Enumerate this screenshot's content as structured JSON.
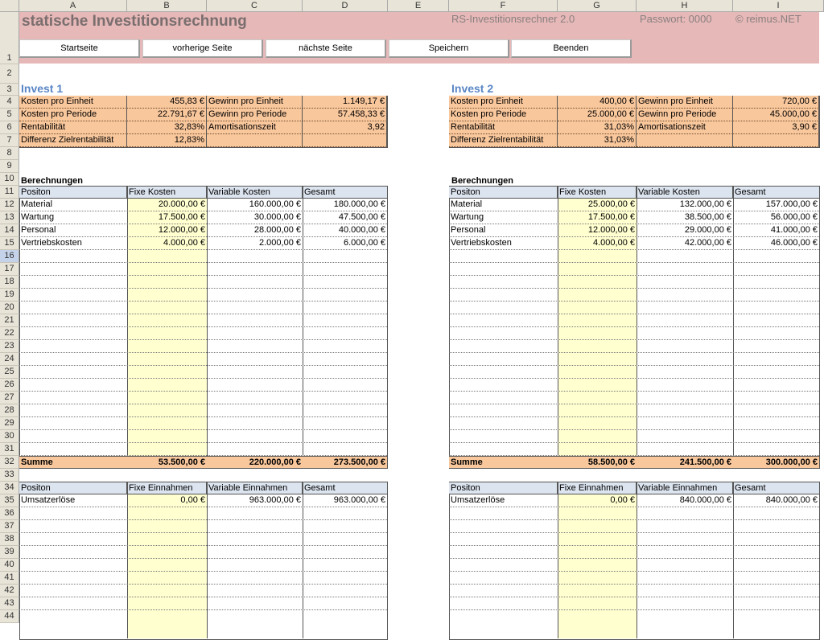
{
  "columns": [
    "A",
    "B",
    "C",
    "D",
    "E",
    "F",
    "G",
    "H",
    "I"
  ],
  "rows": [
    "1",
    "2",
    "3",
    "4",
    "5",
    "6",
    "7",
    "8",
    "9",
    "10",
    "11",
    "12",
    "13",
    "14",
    "15",
    "16",
    "17",
    "18",
    "19",
    "20",
    "21",
    "22",
    "23",
    "24",
    "25",
    "26",
    "27",
    "28",
    "29",
    "30",
    "31",
    "32",
    "33",
    "34",
    "35",
    "36",
    "37",
    "38",
    "39",
    "40",
    "41",
    "42",
    "43",
    "44"
  ],
  "header": {
    "title": "statische Investitionsrechnung",
    "app_name": "RS-Investitionsrechner 2.0",
    "password": "Passwort: 0000",
    "copyright": "© reimus.NET"
  },
  "buttons": {
    "start": "Startseite",
    "prev": "vorherige Seite",
    "next": "nächste Seite",
    "save": "Speichern",
    "exit": "Beenden"
  },
  "colors": {
    "banner": "#e6b8b8",
    "orange": "#f9c79c",
    "yellow": "#ffffd0",
    "header": "#dce4ef",
    "title_blue": "#5a86c6"
  },
  "invest1": {
    "title": "Invest 1",
    "kpi": [
      [
        "Kosten pro Einheit",
        "455,83 €",
        "Gewinn pro Einheit",
        "1.149,17 €"
      ],
      [
        "Kosten pro Periode",
        "22.791,67 €",
        "Gewinn pro Periode",
        "57.458,33 €"
      ],
      [
        "Rentabilität",
        "32,83%",
        "Amortisationszeit",
        "3,92"
      ],
      [
        "Differenz Zielrentabilität",
        "12,83%",
        "",
        ""
      ]
    ],
    "calc_title": "Berechnungen",
    "cost_headers": [
      "Positon",
      "Fixe Kosten",
      "Variable Kosten",
      "Gesamt"
    ],
    "cost_rows": [
      [
        "Material",
        "20.000,00 €",
        "160.000,00 €",
        "180.000,00 €"
      ],
      [
        "Wartung",
        "17.500,00 €",
        "30.000,00 €",
        "47.500,00 €"
      ],
      [
        "Personal",
        "12.000,00 €",
        "28.000,00 €",
        "40.000,00 €"
      ],
      [
        "Vertriebskosten",
        "4.000,00 €",
        "2.000,00 €",
        "6.000,00 €"
      ]
    ],
    "sum": [
      "Summe",
      "53.500,00 €",
      "220.000,00 €",
      "273.500,00 €"
    ],
    "rev_headers": [
      "Positon",
      "Fixe Einnahmen",
      "Variable Einnahmen",
      "Gesamt"
    ],
    "rev_rows": [
      [
        "Umsatzerlöse",
        "0,00 €",
        "963.000,00 €",
        "963.000,00 €"
      ]
    ]
  },
  "invest2": {
    "title": "Invest 2",
    "kpi": [
      [
        "Kosten pro Einheit",
        "400,00 €",
        "Gewinn pro Einheit",
        "720,00 €"
      ],
      [
        "Kosten pro Periode",
        "25.000,00 €",
        "Gewinn pro Periode",
        "45.000,00 €"
      ],
      [
        "Rentabilität",
        "31,03%",
        "Amortisationszeit",
        "3,90 €"
      ],
      [
        "Differenz Zielrentabilität",
        "31,03%",
        "",
        ""
      ]
    ],
    "calc_title": "Berechnungen",
    "cost_headers": [
      "Positon",
      "Fixe Kosten",
      "Variable Kosten",
      "Gesamt"
    ],
    "cost_rows": [
      [
        "Material",
        "25.000,00 €",
        "132.000,00 €",
        "157.000,00 €"
      ],
      [
        "Wartung",
        "17.500,00 €",
        "38.500,00 €",
        "56.000,00 €"
      ],
      [
        "Personal",
        "12.000,00 €",
        "29.000,00 €",
        "41.000,00 €"
      ],
      [
        "Vertriebskosten",
        "4.000,00 €",
        "42.000,00 €",
        "46.000,00 €"
      ]
    ],
    "sum": [
      "Summe",
      "58.500,00 €",
      "241.500,00 €",
      "300.000,00 €"
    ],
    "rev_headers": [
      "Positon",
      "Fixe Einnahmen",
      "Variable Einnahmen",
      "Gesamt"
    ],
    "rev_rows": [
      [
        "Umsatzerlöse",
        "0,00 €",
        "840.000,00 €",
        "840.000,00 €"
      ]
    ]
  }
}
